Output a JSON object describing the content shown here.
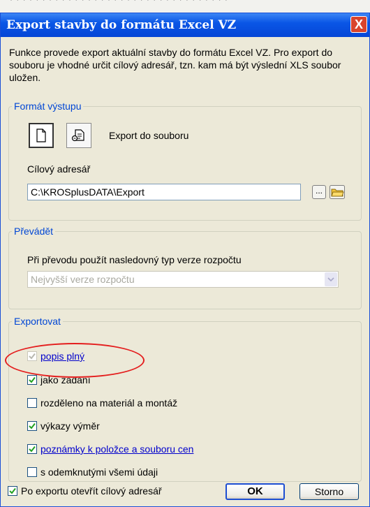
{
  "dialog": {
    "title": "Export stavby do formátu Excel VZ",
    "close_label": "X",
    "description": "Funkce provede export aktuální stavby do formátu Excel VZ. Pro export do souboru je vhodné určit cílový adresář, tzn. kam má být výslední XLS soubor uložen."
  },
  "format_group": {
    "legend": "Formát výstupu",
    "mode_label": "Export do souboru",
    "dir_label": "Cílový adresář",
    "dir_value": "C:\\KROSplusDATA\\Export",
    "browse_label": "..."
  },
  "converter_group": {
    "legend": "Převádět",
    "instruction": "Při převodu použít nasledovný typ verze rozpočtu",
    "version_value": "Nejvyšší verze rozpočtu"
  },
  "export_group": {
    "legend": "Exportovat",
    "options": [
      {
        "label": "popis plný",
        "checked": true,
        "disabled": true,
        "link": true
      },
      {
        "label": "jako zadání",
        "checked": true,
        "disabled": false,
        "link": false
      },
      {
        "label": "rozděleno na materiál a montáž",
        "checked": false,
        "disabled": false,
        "link": false
      },
      {
        "label": "výkazy výměr",
        "checked": true,
        "disabled": false,
        "link": false
      },
      {
        "label": "poznámky k položce a souboru cen",
        "checked": true,
        "disabled": false,
        "link": true
      },
      {
        "label": "s odemknutými všemi údaji",
        "checked": false,
        "disabled": false,
        "link": false
      }
    ]
  },
  "footer": {
    "open_dir_label": "Po exportu otevřít cílový adresář",
    "open_dir_checked": true,
    "ok_label": "OK",
    "cancel_label": "Storno"
  },
  "colors": {
    "titlebar": "#0a56e6",
    "legend_text": "#0046d5",
    "link_text": "#0000cc",
    "annotation_ellipse": "#e41e1e"
  }
}
